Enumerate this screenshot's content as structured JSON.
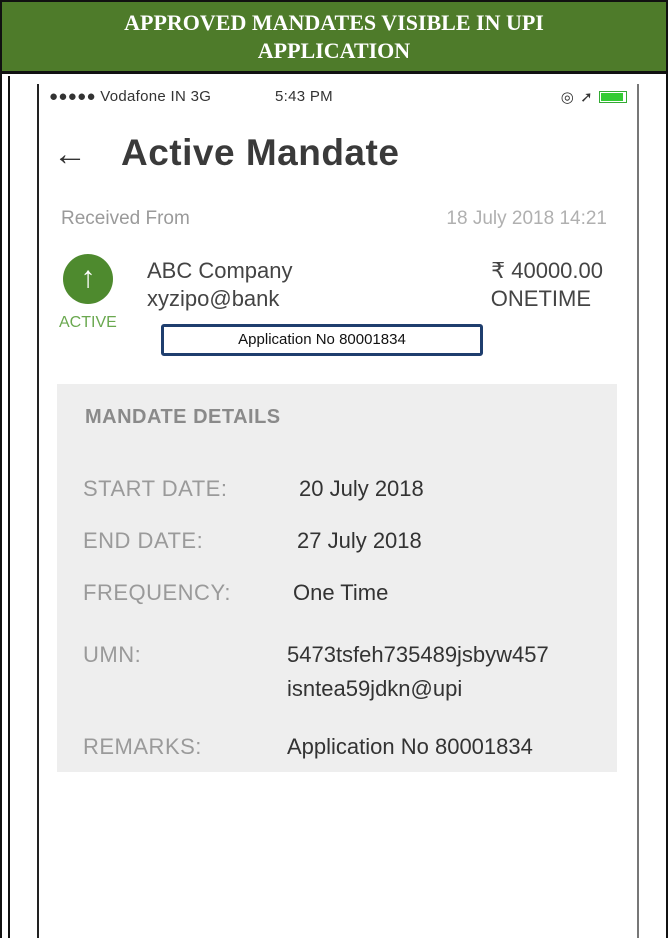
{
  "banner": {
    "title": "APPROVED MANDATES VISIBLE IN UPI APPLICATION"
  },
  "status_bar": {
    "carrier": "●●●●● Vodafone IN  3G",
    "time": "5:43 PM",
    "icons": [
      "alarm-icon",
      "location-icon",
      "battery-icon"
    ]
  },
  "header": {
    "back_icon": "back-arrow-icon",
    "back_glyph": "←",
    "title": "Active Mandate"
  },
  "mandate": {
    "received_from_label": "Received From",
    "received_date": "18 July 2018 14:21",
    "status_icon": "up-arrow-icon",
    "status_glyph": "↑",
    "status": "ACTIVE",
    "payee_name": "ABC Company",
    "payee_vpa": "xyzipo@bank",
    "amount": "₹ 40000.00",
    "frequency_tag": "ONETIME",
    "application_no": "Application No 80001834",
    "status_color": "#4e8a2e"
  },
  "details": {
    "heading": "MANDATE DETAILS",
    "rows": [
      {
        "label": "START DATE:",
        "value": "20 July 2018"
      },
      {
        "label": "END DATE:",
        "value": "27 July 2018"
      },
      {
        "label": "FREQUENCY:",
        "value": "One Time"
      },
      {
        "label": "UMN:",
        "value": "5473tsfeh735489jsbyw457",
        "value2": "isntea59jdkn@upi"
      },
      {
        "label": "REMARKS:",
        "value": "Application No 80001834"
      }
    ]
  },
  "colors": {
    "banner_bg": "#4e7b2a",
    "card_bg": "#eeeeee",
    "app_no_border": "#1f3e6e"
  }
}
